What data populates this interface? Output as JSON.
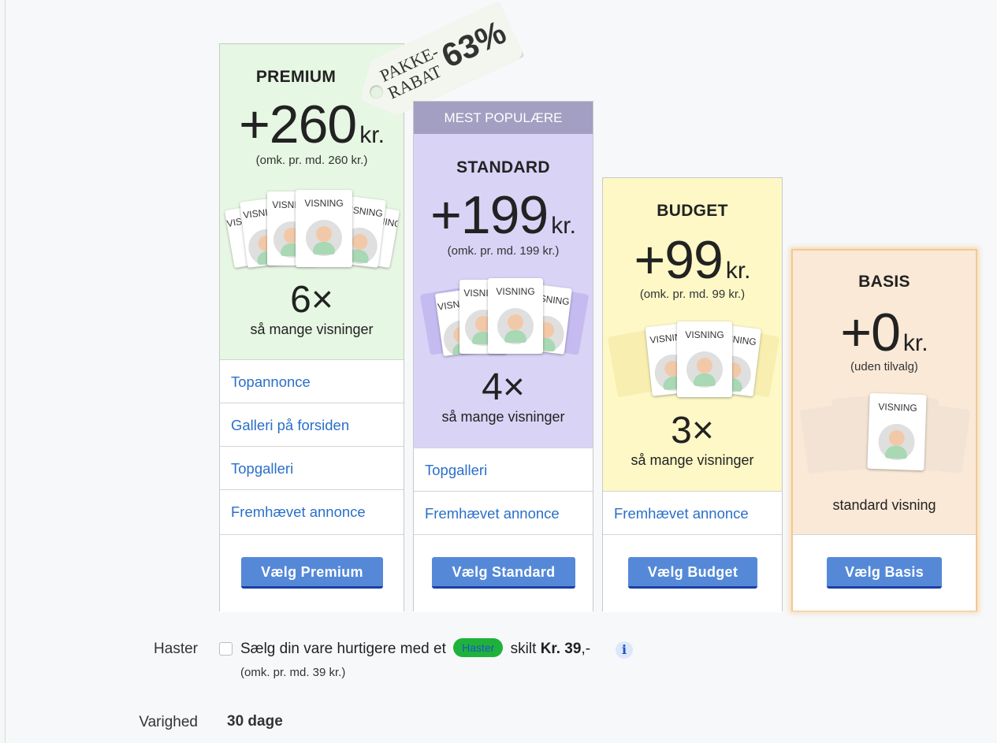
{
  "colors": {
    "premium_bg": "#e6f7e3",
    "standard_bg": "#d9d3f6",
    "standard_banner": "#a29fc2",
    "budget_bg": "#fdf8c6",
    "basis_bg": "#fae9d7",
    "link": "#2a6fc9",
    "button": "#5589d8",
    "button_border": "#1b3fa5",
    "haster_pill": "#1fb23b"
  },
  "discount_tag": {
    "line1": "PAKKE-",
    "line2": "RABAT",
    "percent": "63%"
  },
  "plans": [
    {
      "name": "PREMIUM",
      "price": "+260",
      "unit": "kr.",
      "per_month": "(omk. pr. md. 260 kr.)",
      "card_label": "VISNING",
      "multiplier": "6×",
      "multiplier_label": "så mange visninger",
      "features": [
        "Topannonce",
        "Galleri på forsiden",
        "Topgalleri",
        "Fremhævet annonce"
      ],
      "button": "Vælg Premium"
    },
    {
      "banner": "MEST POPULÆRE",
      "name": "STANDARD",
      "price": "+199",
      "unit": "kr.",
      "per_month": "(omk. pr. md. 199 kr.)",
      "card_label": "VISNING",
      "multiplier": "4×",
      "multiplier_label": "så mange visninger",
      "features": [
        "Topgalleri",
        "Fremhævet annonce"
      ],
      "button": "Vælg Standard"
    },
    {
      "name": "BUDGET",
      "price": "+99",
      "unit": "kr.",
      "per_month": "(omk. pr. md. 99 kr.)",
      "card_label": "VISNING",
      "multiplier": "3×",
      "multiplier_label": "så mange visninger",
      "features": [
        "Fremhævet annonce"
      ],
      "button": "Vælg Budget"
    },
    {
      "name": "BASIS",
      "price": "+0",
      "unit": "kr.",
      "per_month": "(uden tilvalg)",
      "card_label": "VISNING",
      "description": "standard visning",
      "button": "Vælg Basis",
      "selected": true
    }
  ],
  "haster": {
    "label": "Haster",
    "text_before": "Sælg din vare hurtigere med et",
    "pill": "Haster",
    "text_after": "skilt",
    "price": "Kr. 39",
    "price_suffix": ",-",
    "sub": "(omk. pr. md. 39 kr.)",
    "checked": false
  },
  "duration": {
    "label": "Varighed",
    "value": "30 dage"
  }
}
